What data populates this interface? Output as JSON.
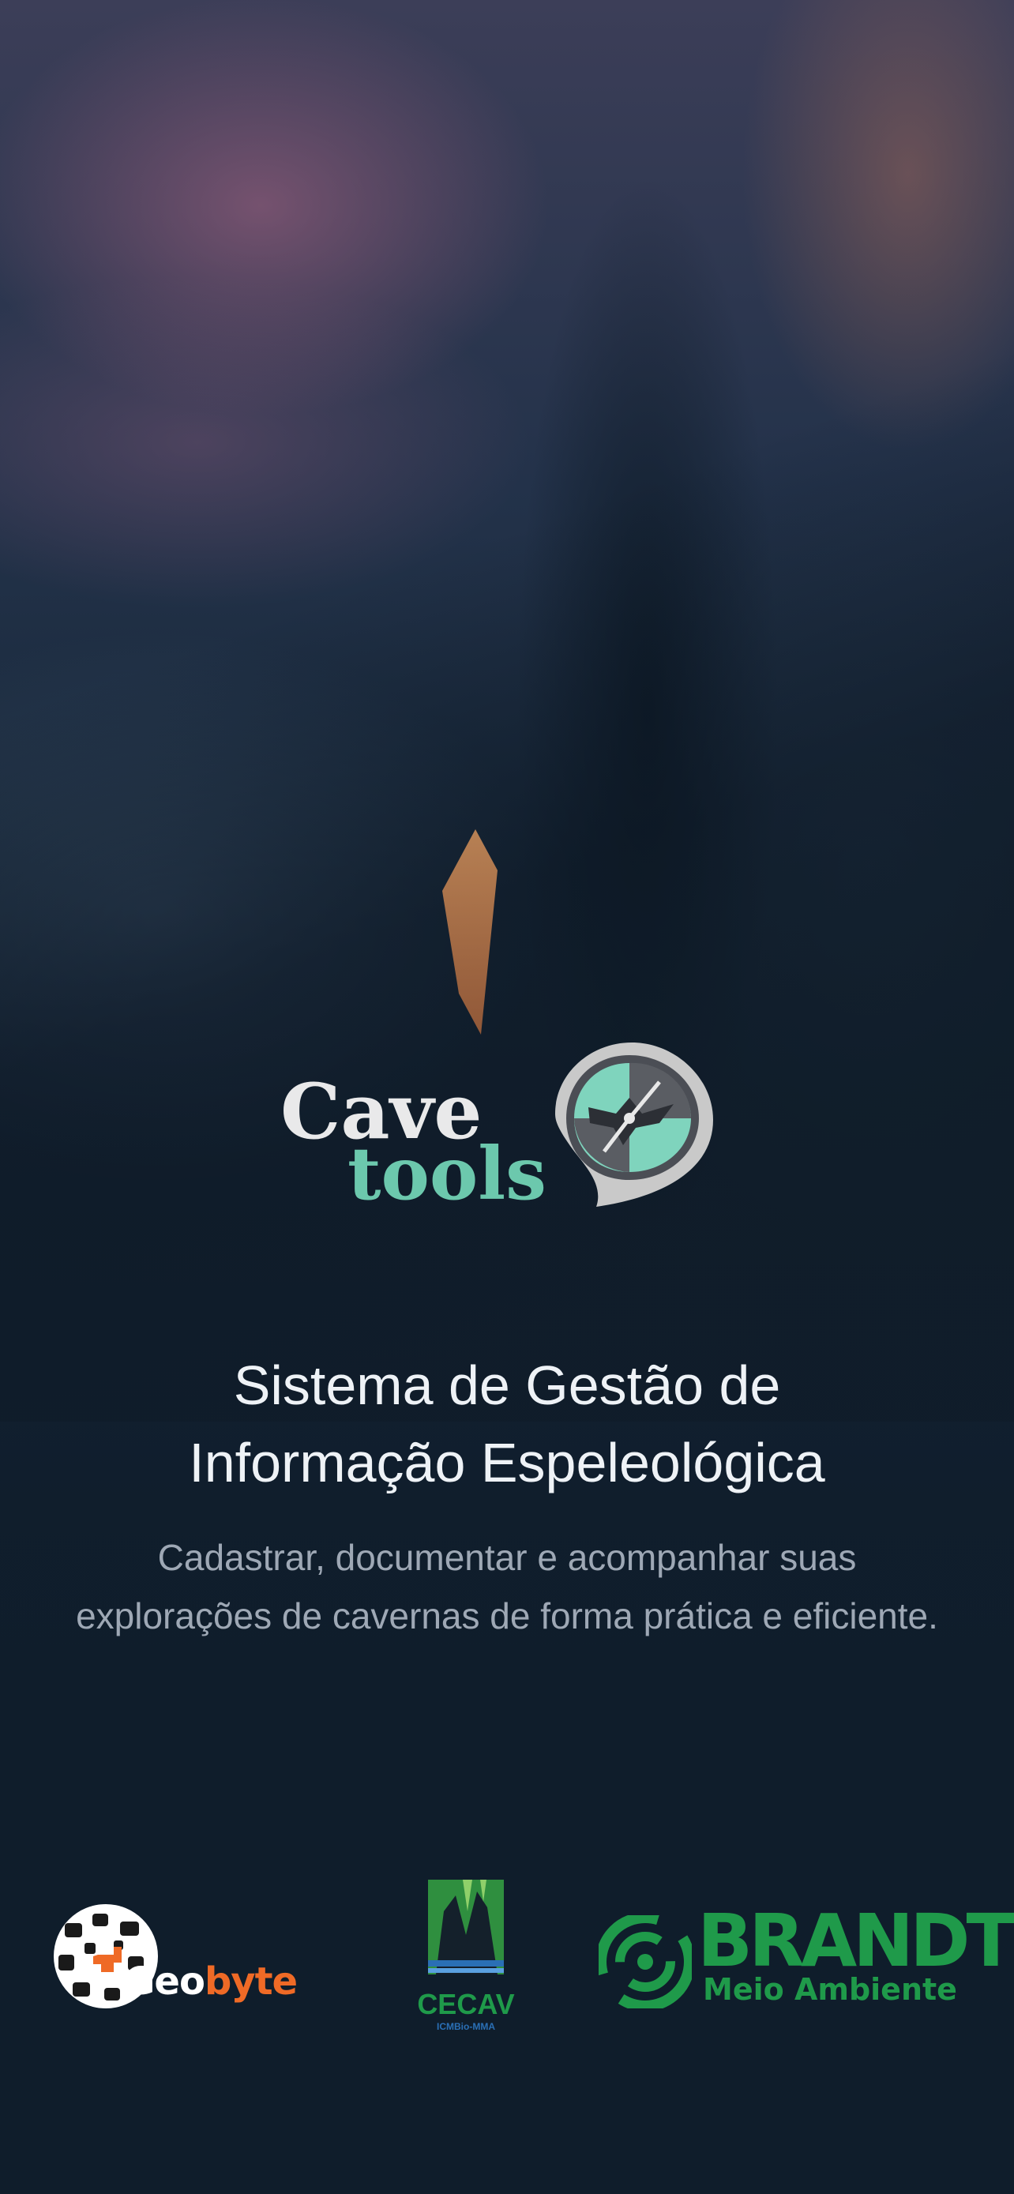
{
  "logo": {
    "line1": "Cave",
    "line2": "tools",
    "icon": "compass-pin-icon"
  },
  "headline": {
    "line1": "Sistema de Gestão de",
    "line2": "Informação Espeleológica"
  },
  "description": "Cadastrar, documentar e acompanhar suas explorações de cavernas de forma prática e eficiente.",
  "partners": {
    "geobyte": {
      "part1": "Geo",
      "part2": "byte"
    },
    "cecav": {
      "name": "CECAV",
      "sub": "ICMBio-MMA"
    },
    "brandt": {
      "name": "BRANDT",
      "sub": "Meio Ambiente"
    }
  },
  "colors": {
    "background": "#0f1d2b",
    "accent_teal": "#6cc8ad",
    "partner_green": "#1f9a4a",
    "geobyte_orange": "#ef6a26"
  }
}
